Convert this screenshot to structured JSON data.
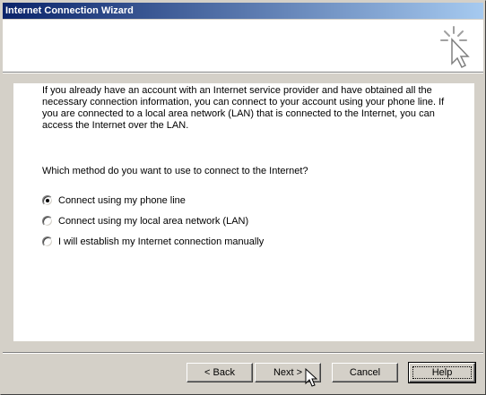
{
  "window": {
    "title": "Internet Connection Wizard"
  },
  "content": {
    "intro": "If you already have an account with an Internet service provider and have obtained all the necessary connection information, you can connect to your account using your phone line. If you are connected to a local area network (LAN) that is connected to the Internet, you can access the Internet over the LAN.",
    "question": "Which method do you want to use to connect to the Internet?",
    "options": [
      {
        "label": "Connect using my phone line",
        "selected": true
      },
      {
        "label": "Connect using my local area network (LAN)",
        "selected": false
      },
      {
        "label": "I will establish my Internet connection manually",
        "selected": false
      }
    ]
  },
  "buttons": {
    "back": "< Back",
    "next": "Next >",
    "cancel": "Cancel",
    "help": "Help"
  },
  "icons": {
    "wizard": "wizard-cursor-sparkle-icon",
    "mouse": "mouse-pointer-icon"
  }
}
